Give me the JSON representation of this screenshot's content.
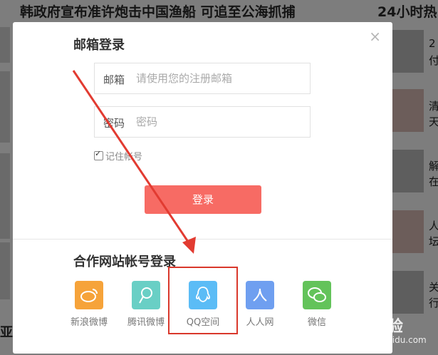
{
  "background": {
    "headline": "韩政府宣布准许炮击中国渔船 可追至公海抓捕",
    "right_title": "24小时热",
    "left_bottom_text": "亚",
    "right_snippets": [
      "2",
      "付",
      "清",
      "天",
      "解",
      "在",
      "人",
      "坛",
      "关",
      "行"
    ]
  },
  "modal": {
    "close_glyph": "×",
    "login_title": "邮箱登录",
    "email": {
      "label": "邮箱",
      "placeholder": "请使用您的注册邮箱",
      "value": ""
    },
    "password": {
      "label": "密码",
      "placeholder": "密码",
      "value": ""
    },
    "remember_label": "记住帐号",
    "remember_checked": true,
    "login_button": "登录",
    "partner_title": "合作网站帐号登录",
    "socials": [
      {
        "name": "weibo",
        "label": "新浪微博",
        "color": "#f6a33a",
        "icon": "weibo-icon"
      },
      {
        "name": "tencent-weibo",
        "label": "腾讯微博",
        "color": "#69cfc5",
        "icon": "tencent-weibo-icon"
      },
      {
        "name": "qzone",
        "label": "QQ空间",
        "color": "#5bbcf6",
        "icon": "qq-icon"
      },
      {
        "name": "renren",
        "label": "人人网",
        "color": "#6f9ff0",
        "icon": "renren-icon"
      },
      {
        "name": "wechat",
        "label": "微信",
        "color": "#63c35a",
        "icon": "wechat-icon"
      }
    ]
  },
  "watermark": {
    "brand": "Bai 经验",
    "sub": "jingyan.baidu.com"
  },
  "colors": {
    "login_button": "#f76b64",
    "highlight": "#d9382c",
    "overlay": "#7d7d7d"
  }
}
